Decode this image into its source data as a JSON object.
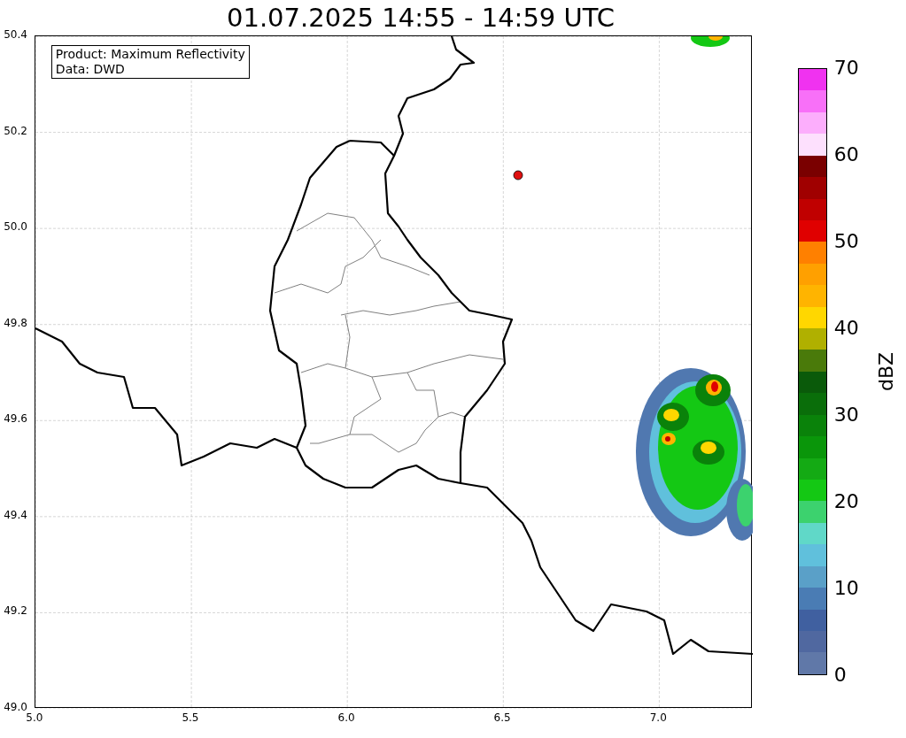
{
  "title": "01.07.2025 14:55 - 14:59 UTC",
  "map": {
    "info_box": [
      "Product: Maximum Reflectivity",
      "Data: DWD"
    ],
    "x_ticks": [
      "5.0",
      "5.5",
      "6.0",
      "6.5",
      "7.0"
    ],
    "y_ticks": [
      "50.4",
      "50.2",
      "50.0",
      "49.8",
      "49.6",
      "49.4",
      "49.2",
      "49.0"
    ]
  },
  "colorbar": {
    "label": "dBZ",
    "ticks": [
      "70",
      "60",
      "50",
      "40",
      "30",
      "20",
      "10",
      "0"
    ],
    "segments": [
      {
        "color": "#f032f0"
      },
      {
        "color": "#f870f8"
      },
      {
        "color": "#fcaefc"
      },
      {
        "color": "#fde0fd"
      },
      {
        "color": "#7a0000"
      },
      {
        "color": "#a00000"
      },
      {
        "color": "#c00000"
      },
      {
        "color": "#e00000"
      },
      {
        "color": "#ff8000"
      },
      {
        "color": "#ffa000"
      },
      {
        "color": "#ffb400"
      },
      {
        "color": "#ffd700"
      },
      {
        "color": "#b0b000"
      },
      {
        "color": "#4a7a0a"
      },
      {
        "color": "#0a5a0a"
      },
      {
        "color": "#0a6e0a"
      },
      {
        "color": "#0a820a"
      },
      {
        "color": "#0a960a"
      },
      {
        "color": "#14aa14"
      },
      {
        "color": "#14c814"
      },
      {
        "color": "#3cd26e"
      },
      {
        "color": "#60d8c8"
      },
      {
        "color": "#60c0dc"
      },
      {
        "color": "#5aa0c8"
      },
      {
        "color": "#4a7cb4"
      },
      {
        "color": "#4060a0"
      },
      {
        "color": "#5068a0"
      },
      {
        "color": "#6078a8"
      }
    ]
  }
}
